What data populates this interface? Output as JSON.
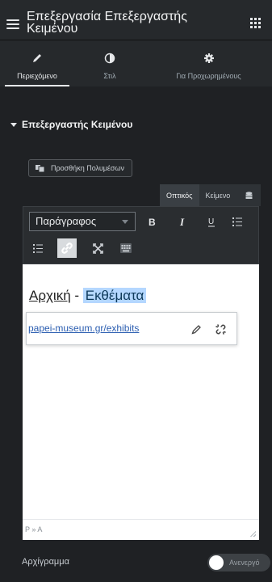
{
  "header": {
    "title": "Επεξεργασία Επεξεργαστής Κειμένου"
  },
  "tabs": [
    {
      "label": "Περιεχόμενο",
      "icon": "pencil-icon",
      "active": true
    },
    {
      "label": "Στιλ",
      "icon": "contrast-icon",
      "active": false
    },
    {
      "label": "Για Προχωρημένους",
      "icon": "gear-icon",
      "active": false
    }
  ],
  "section": {
    "title": "Επεξεργαστής Κειμένου"
  },
  "editor": {
    "add_media_label": "Προσθήκη Πολυμέσων",
    "mode_tabs": {
      "visual": "Οπτικός",
      "text": "Κείμενο"
    },
    "format_select": "Παράγραφος",
    "content": {
      "link_text": "Αρχική",
      "separator": " - ",
      "selected_text": "Εκθέματα"
    },
    "link_popup": {
      "url": "papei-museum.gr/exhibits"
    },
    "path": "P » A"
  },
  "dropcap": {
    "label": "Αρχίγραμμα",
    "toggle_text": "Ανενεργό",
    "enabled": false
  },
  "colors": {
    "panel": "#1f2124",
    "header": "#26292c",
    "selection": "#b4d7ff",
    "link": "#2a5db0"
  }
}
